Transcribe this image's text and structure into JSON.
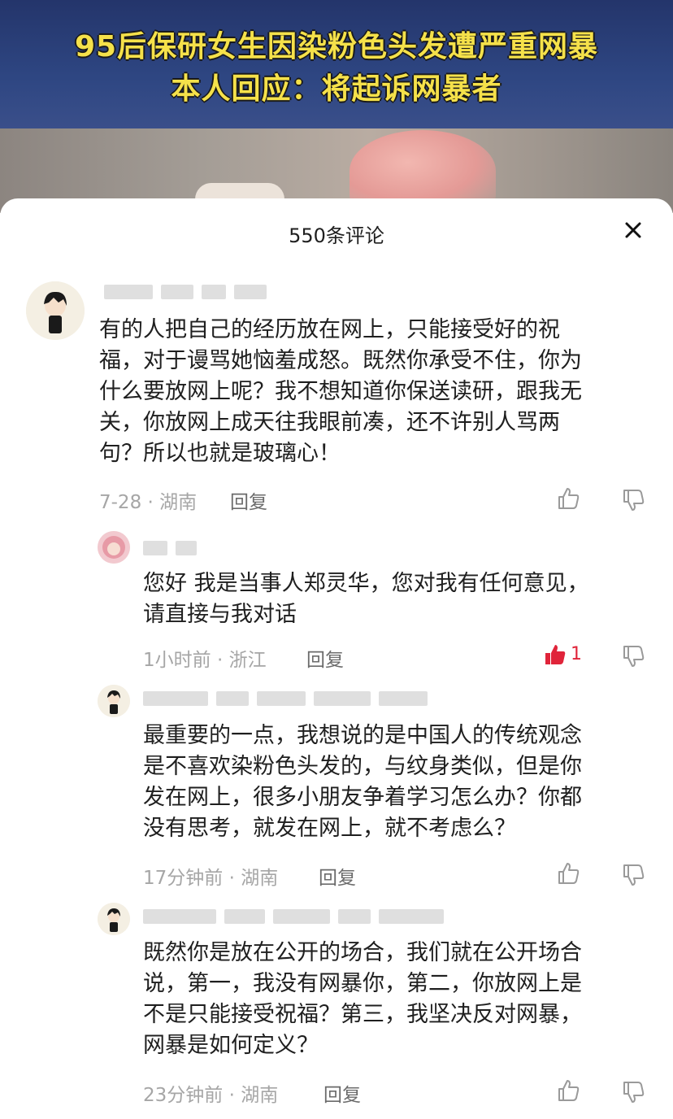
{
  "video": {
    "headline_line1": "95后保研女生因染粉色头发遭严重网暴",
    "headline_line2": "本人回应：将起诉网暴者"
  },
  "sheet": {
    "title": "550条评论"
  },
  "comments": [
    {
      "text_lines": [
        "有的人把自己的经历放在网上，只能接受好的祝",
        "福，对于谩骂她恼羞成怒。既然你承受不住，你为",
        "什么要放网上呢？我不想知道你保送读研，跟我无",
        "关，你放网上成天往我眼前凑，还不许别人骂两",
        "句？所以也就是玻璃心！"
      ],
      "meta": "7-28 · 湖南",
      "reply_label": "回复"
    },
    {
      "text_lines": [
        "您好 我是当事人郑灵华，您对我有任何意见，",
        "请直接与我对话"
      ],
      "meta": "1小时前 · 浙江",
      "reply_label": "回复",
      "like_count": "1"
    },
    {
      "text_lines": [
        "最重要的一点，我想说的是中国人的传统观念",
        "是不喜欢染粉色头发的，与纹身类似，但是你",
        "发在网上，很多小朋友争着学习怎么办？你都",
        "没有思考，就发在网上，就不考虑么？"
      ],
      "meta": "17分钟前 · 湖南",
      "reply_label": "回复"
    },
    {
      "text_lines": [
        "既然你是放在公开的场合，我们就在公开场合",
        "说，第一，我没有网暴你，第二，你放网上是",
        "不是只能接受祝福？第三，我坚决反对网暴，",
        "网暴是如何定义？"
      ],
      "meta": "23分钟前 · 湖南",
      "reply_label": "回复"
    }
  ],
  "colors": {
    "headline": "#f5e14a",
    "liked": "#e0243a",
    "meta_text": "#a6a6a6"
  },
  "icons": [
    "close-icon",
    "thumbs-up-icon",
    "thumbs-down-icon"
  ]
}
